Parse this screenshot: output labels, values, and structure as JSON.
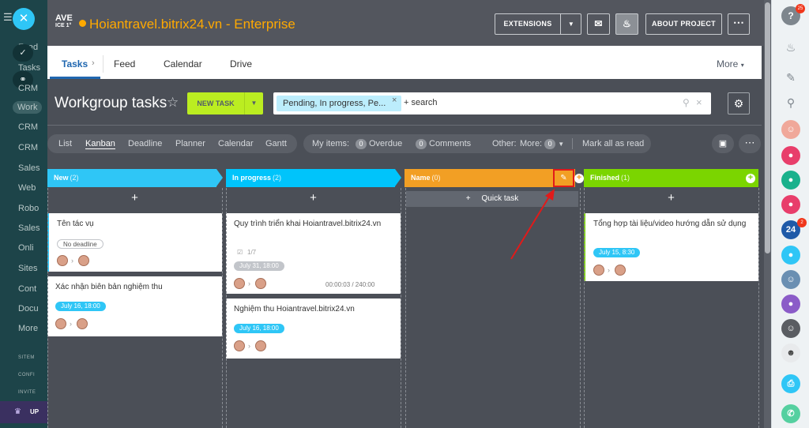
{
  "left_sidebar": {
    "items": [
      "Feed",
      "Tasks",
      "CRM",
      "Work",
      "CRM",
      "CRM",
      "Sales",
      "Web",
      "Robo",
      "Sales",
      "Onli",
      "Sites",
      "Cont",
      "Docu",
      "More"
    ],
    "small_items": [
      "SITEM",
      "CONFI",
      "INVITE"
    ],
    "bottom_label": "UP"
  },
  "header": {
    "logo_line1": "AVE",
    "logo_line2": "ICE 1°",
    "title": "Hoiantravel.bitrix24.vn - Enterprise",
    "extensions_label": "EXTENSIONS",
    "about_label": "ABOUT PROJECT"
  },
  "tabs": {
    "items": [
      "Tasks",
      "Feed",
      "Calendar",
      "Drive"
    ],
    "more_label": "More"
  },
  "toolbar": {
    "page_title": "Workgroup tasks",
    "new_task_label": "NEW TASK",
    "filter_tag": "Pending, In progress, Pe...",
    "search_text": "+ search"
  },
  "viewbar": {
    "views": [
      "List",
      "Kanban",
      "Deadline",
      "Planner",
      "Calendar",
      "Gantt"
    ],
    "active_view": "Kanban",
    "my_items_label": "My items:",
    "overdue_count": "0",
    "overdue_label": "Overdue",
    "comments_count": "0",
    "comments_label": "Comments",
    "other_label": "Other:",
    "more_label": "More:",
    "more_count": "0",
    "mark_all_label": "Mark all as read"
  },
  "columns": [
    {
      "title": "New",
      "count": "(2)",
      "color": "#2fc6f6"
    },
    {
      "title": "In progress",
      "count": "(2)",
      "color": "#00c4fb"
    },
    {
      "title": "Name",
      "count": "(0)",
      "color": "#f29f24"
    },
    {
      "title": "Finished",
      "count": "(1)",
      "color": "#7bd500"
    }
  ],
  "quick_task_label": "Quick task",
  "cards": {
    "c1": {
      "title": "Tên tác vụ",
      "badge": "No deadline"
    },
    "c2": {
      "title": "Xác nhận biên bản nghiệm thu",
      "badge": "July 16, 18:00"
    },
    "c3": {
      "title": "Quy trình triển khai Hoiantravel.bitrix24.vn",
      "checklist": "1/7",
      "badge": "July 31, 18:00",
      "timer": "00:00:03 / 240:00"
    },
    "c4": {
      "title": "Nghiệm thu Hoiantravel.bitrix24.vn",
      "badge": "July 16, 18:00"
    },
    "c5": {
      "title": "Tổng hợp tài liệu/video hướng dẫn sử dụng",
      "badge": "July 15, 8:30"
    }
  },
  "rightbar": {
    "help_badge": "25",
    "b24_label": "24",
    "b24_badge": "2"
  },
  "colors": {
    "accent_blue": "#2067b0",
    "new_task_green": "#bbed21",
    "deadline_blue": "#2fc6f6",
    "annotation_red": "#e11a1a"
  }
}
